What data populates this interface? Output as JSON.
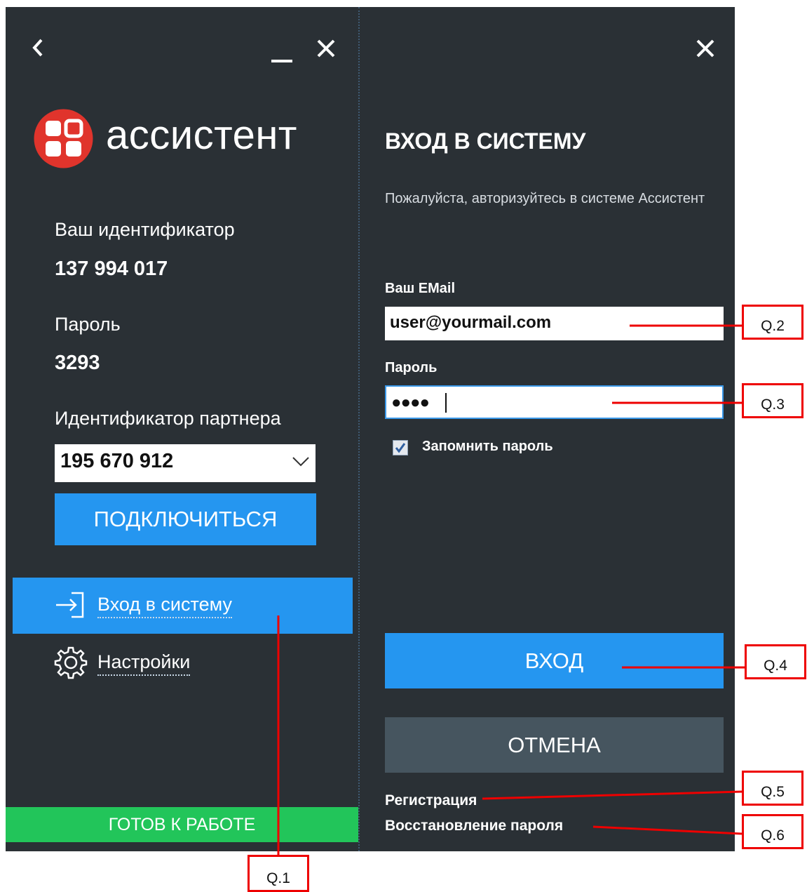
{
  "left_panel": {
    "brand": "ассистент",
    "id_label": "Ваш идентификатор",
    "id_value": "137 994 017",
    "password_label": "Пароль",
    "password_value": "3293",
    "partner_label": "Идентификатор партнера",
    "partner_value": "195 670 912",
    "connect_button": "ПОДКЛЮЧИТЬСЯ",
    "menu": {
      "login": "Вход в систему",
      "settings": "Настройки"
    },
    "status": "ГОТОВ К РАБОТЕ"
  },
  "right_panel": {
    "title": "ВХОД В СИСТЕМУ",
    "subtitle": "Пожалуйста, авторизуйтесь в системе Ассистент",
    "email_label": "Ваш EMail",
    "email_value": "user@yourmail.com",
    "password_label": "Пароль",
    "password_value": "●●●●",
    "remember_label": "Запомнить пароль",
    "remember_checked": true,
    "login_button": "ВХОД",
    "cancel_button": "ОТМЕНА",
    "register_link": "Регистрация",
    "restore_link": "Восстановление пароля"
  },
  "annotations": {
    "q1": "Q.1",
    "q2": "Q.2",
    "q3": "Q.3",
    "q4": "Q.4",
    "q5": "Q.5",
    "q6": "Q.6"
  },
  "colors": {
    "background": "#2a3035",
    "accent": "#2596f0",
    "cancel": "#46555f",
    "status_ok": "#22c55a",
    "logo_red": "#e0342c",
    "annotation": "#ee0000"
  },
  "icons": [
    "back-icon",
    "minimize-icon",
    "close-icon",
    "app-logo-icon",
    "login-icon",
    "gear-icon",
    "chevron-down-icon",
    "checkbox-checked-icon"
  ]
}
